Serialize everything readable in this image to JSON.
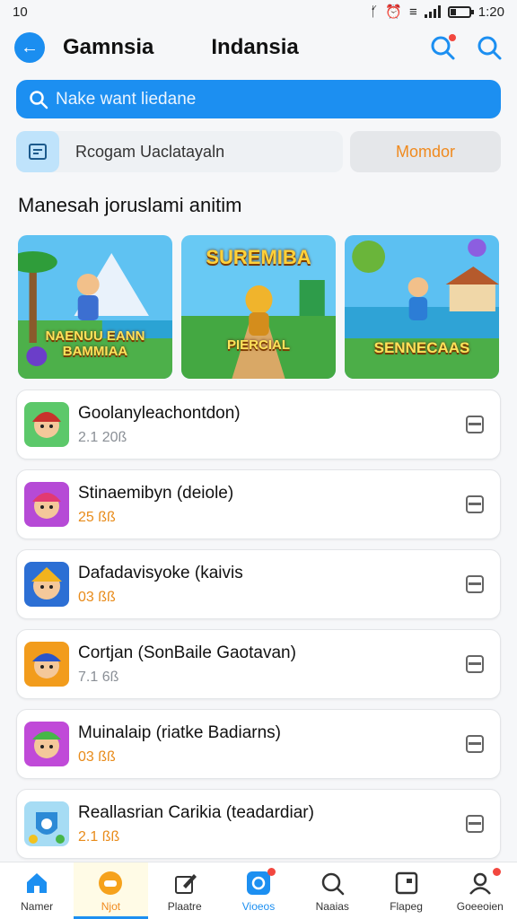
{
  "status": {
    "left": "10",
    "time": "1:20"
  },
  "header": {
    "title": "Gamnsia",
    "subtitle": "Indansia"
  },
  "search": {
    "placeholder": "Nake want liedane"
  },
  "program": {
    "label": "Rcogam Uaclatayaln",
    "button": "Momdor"
  },
  "section": {
    "title": "Manesah joruslami anitim"
  },
  "banners": [
    {
      "label_top": "SUREMIBA",
      "label_bottom": "PIERCIAL"
    },
    {
      "label_top": "",
      "label_bottom": "NAENUU EANN BAMMIAA"
    },
    {
      "label_top": "",
      "label_bottom": "SENNECAAS"
    }
  ],
  "apps": [
    {
      "name": "Goolanyleachontdon)",
      "meta": "2.1 20ß",
      "meta_color": "#8a8f96"
    },
    {
      "name": "Stinaemibyn (deiole)",
      "meta": "25 ßß",
      "meta_color": "#e88b1a"
    },
    {
      "name": "Dafadavisyoke (kaivis",
      "meta": "03 ßß",
      "meta_color": "#e88b1a"
    },
    {
      "name": "Cortjan (SonBaile Gaotavan)",
      "meta": "7.1 6ß",
      "meta_color": "#8a8f96"
    },
    {
      "name": "Muinalaip (riatke Badiarns)",
      "meta": "03 ßß",
      "meta_color": "#e88b1a"
    },
    {
      "name": "Reallasrian Carikia (teadardiar)",
      "meta": "2.1 ßß",
      "meta_color": "#e88b1a"
    }
  ],
  "nav": [
    {
      "label": "Namer",
      "icon": "home-icon"
    },
    {
      "label": "Njot",
      "icon": "game-icon"
    },
    {
      "label": "Plaatre",
      "icon": "edit-icon"
    },
    {
      "label": "Vioeos",
      "icon": "video-icon"
    },
    {
      "label": "Naaias",
      "icon": "search-icon"
    },
    {
      "label": "Flapeg",
      "icon": "card-icon"
    },
    {
      "label": "Goeeoien",
      "icon": "profile-icon"
    }
  ],
  "colors": {
    "accent": "#1c8ff1",
    "orange": "#f08a1e",
    "badge": "#f2473f"
  }
}
